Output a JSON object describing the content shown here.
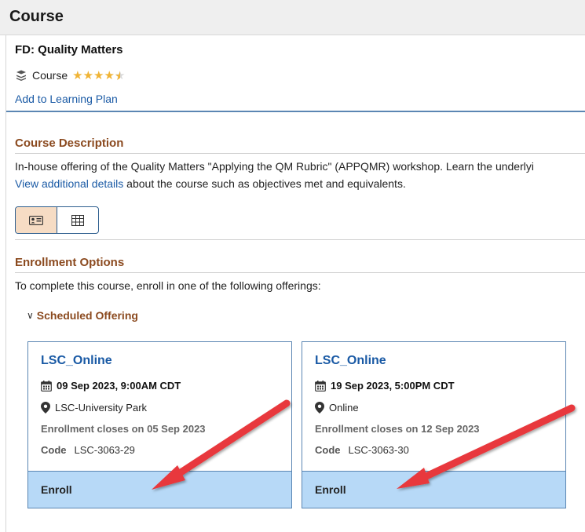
{
  "header": {
    "title": "Course"
  },
  "summary": {
    "course_name": "FD: Quality Matters",
    "type_label": "Course",
    "rating_stars": 4.5,
    "add_plan_label": "Add to Learning Plan"
  },
  "description": {
    "heading": "Course Description",
    "text": "In-house offering of the Quality Matters \"Applying the QM Rubric\" (APPQMR) workshop. Learn the underlyi",
    "link_text": "View additional details",
    "link_suffix": " about the course such as objectives met and equivalents."
  },
  "view_toggle": {
    "selected": "card-view",
    "options": [
      "card-view-icon",
      "table-view-icon"
    ]
  },
  "enrollment": {
    "heading": "Enrollment Options",
    "intro": "To complete this course, enroll in one of the following offerings:",
    "group_label": "Scheduled Offering",
    "offerings": [
      {
        "name": "LSC_Online",
        "date": "09 Sep 2023, 9:00AM CDT",
        "location": "LSC-University Park",
        "closes": "Enrollment closes on 05 Sep 2023",
        "code_label": "Code",
        "code": "LSC-3063-29",
        "enroll_label": "Enroll"
      },
      {
        "name": "LSC_Online",
        "date": "19 Sep 2023, 5:00PM CDT",
        "location": "Online",
        "closes": "Enrollment closes on 12 Sep 2023",
        "code_label": "Code",
        "code": "LSC-3063-30",
        "enroll_label": "Enroll"
      }
    ]
  },
  "colors": {
    "link": "#1a5aa5",
    "section_heading": "#8b4a1f",
    "star": "#f0b436",
    "enroll_bg": "#b7d9f7",
    "annotation_arrow": "#e8393c"
  }
}
